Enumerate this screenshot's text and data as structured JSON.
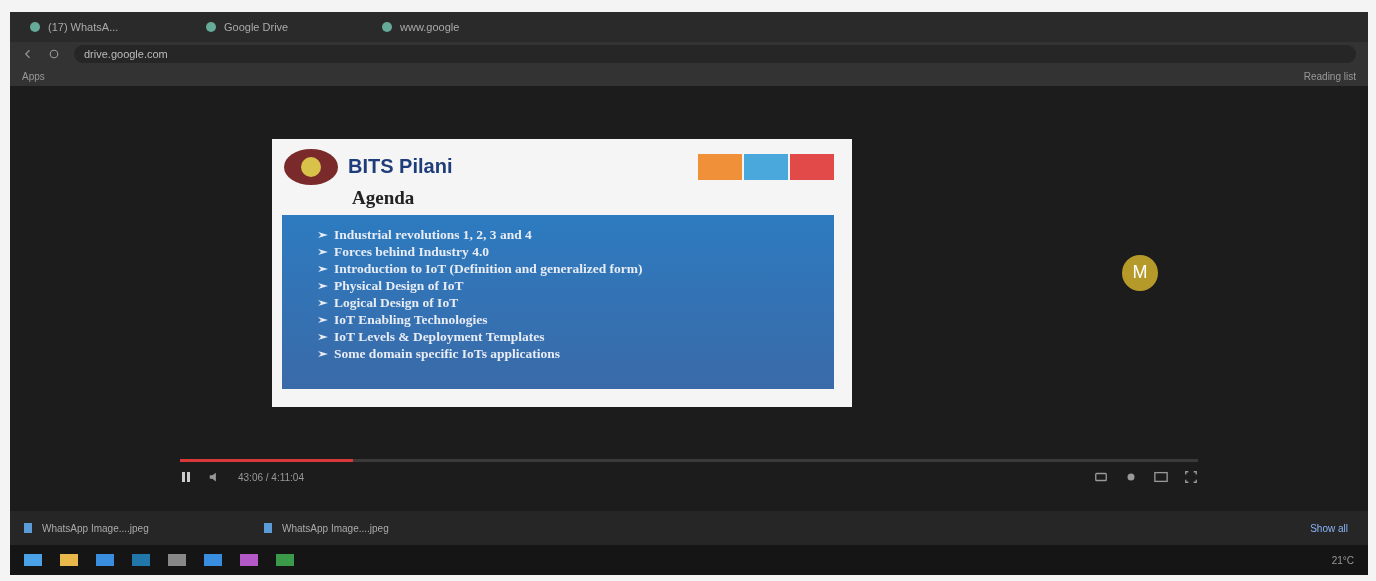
{
  "browser": {
    "tabs": [
      {
        "title": "(17) WhatsA...",
        "selected": false
      },
      {
        "title": "Google Drive",
        "selected": false
      },
      {
        "title": "www.google",
        "selected": false
      }
    ],
    "address": "drive.google.com",
    "bookmarks": [
      "Apps"
    ],
    "reading_list": "Reading list"
  },
  "slide": {
    "brand": "BITS Pilani",
    "title": "Agenda",
    "bullets": [
      "Industrial revolutions 1, 2, 3 and 4",
      "Forces behind Industry 4.0",
      "Introduction to IoT (Definition and generalized form)",
      "Physical Design of IoT",
      "Logical Design of IoT",
      "IoT Enabling Technologies",
      "IoT Levels & Deployment Templates",
      "Some domain specific IoTs applications"
    ]
  },
  "participant": {
    "initial": "M"
  },
  "player": {
    "playing": true,
    "level": 0.17,
    "time": "43:06 / 4:11:04"
  },
  "downloads": {
    "items": [
      "WhatsApp Image....jpeg",
      "WhatsApp Image....jpeg"
    ],
    "show_all": "Show all"
  },
  "taskbar": {
    "temperature": "21°C"
  }
}
